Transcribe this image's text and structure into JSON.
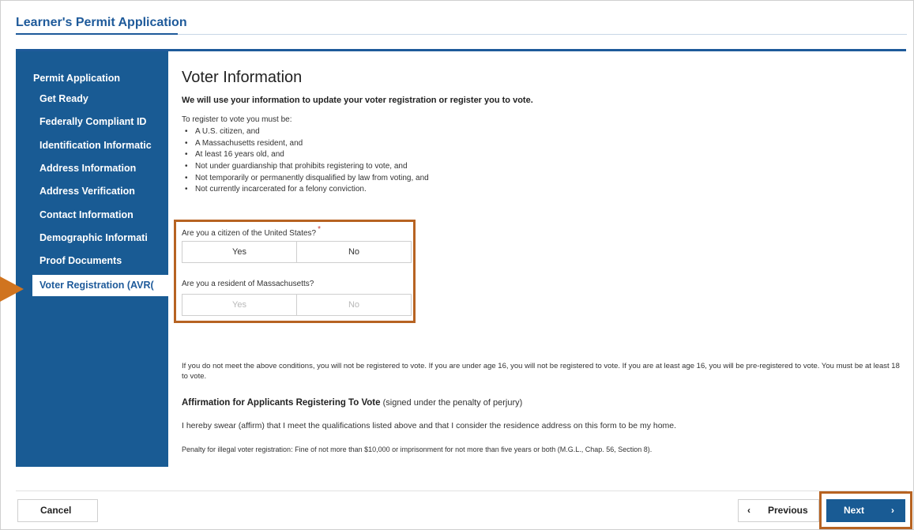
{
  "app": {
    "title": "Learner's Permit Application"
  },
  "sidebar": {
    "heading": "Permit Application",
    "items": [
      {
        "label": "Get Ready"
      },
      {
        "label": "Federally Compliant ID"
      },
      {
        "label": "Identification Informatic"
      },
      {
        "label": "Address Information"
      },
      {
        "label": "Address Verification"
      },
      {
        "label": "Contact Information"
      },
      {
        "label": "Demographic Informati"
      },
      {
        "label": "Proof Documents"
      },
      {
        "label": "Voter Registration (AVR("
      }
    ],
    "active_item": "Voter Registration (AVR("
  },
  "main": {
    "heading": "Voter Information",
    "lead": "We will use your information to update your voter registration or register you to vote.",
    "requirements_intro": "To register to vote you must be:",
    "requirements": [
      "A U.S. citizen, and",
      "A Massachusetts resident, and",
      "At least 16 years old, and",
      "Not under guardianship that prohibits registering to vote, and",
      "Not temporarily or permanently disqualified by law from voting, and",
      "Not currently incarcerated for a felony conviction."
    ],
    "q_citizen": {
      "label": "Are you a citizen of the United States?",
      "required_mark": "*",
      "yes": "Yes",
      "no": "No"
    },
    "q_resident": {
      "label": "Are you a resident of Massachusetts?",
      "yes": "Yes",
      "no": "No"
    },
    "notice": "If you do not meet the above conditions, you will not be registered to vote. If you are under age 16, you will not be registered to vote. If you are at least age 16, you will be pre-registered to vote. You must be at least 18 to vote.",
    "affirmation_heading": "Affirmation for Applicants Registering To Vote",
    "affirmation_note": "(signed under the penalty of perjury)",
    "affirmation_text": "I hereby swear (affirm) that I meet the qualifications listed above and that I consider the residence address on this form to be my home.",
    "penalty": "Penalty for illegal voter registration: Fine of not more than $10,000 or imprisonment for not more than five years or both (M.G.L., Chap. 56, Section 8)."
  },
  "footer": {
    "cancel": "Cancel",
    "previous": "Previous",
    "next": "Next",
    "prev_chevron": "‹",
    "next_chevron": "›"
  },
  "colors": {
    "brand_blue": "#195b94",
    "highlight_orange": "#b76322",
    "required_red": "#c53b36"
  },
  "icons": {
    "pointer": "arrow-pointer-icon",
    "previous": "chevron-left-icon",
    "next": "chevron-right-icon"
  }
}
